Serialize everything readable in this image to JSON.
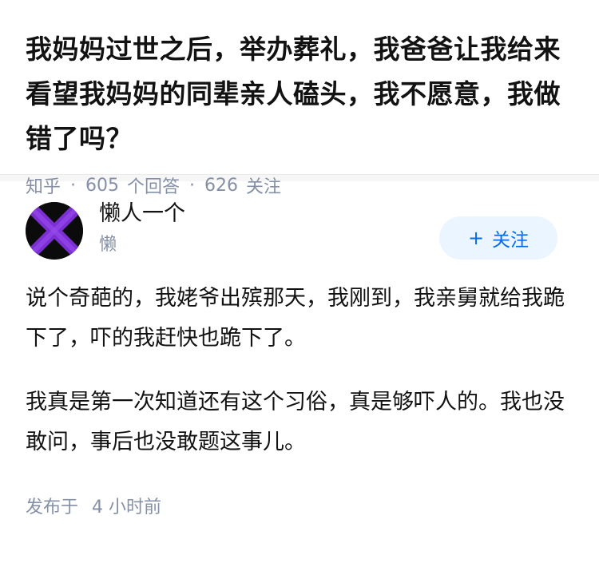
{
  "question": {
    "title": "我妈妈过世之后，举办葬礼，我爸爸让我给来看望我妈妈的同辈亲人磕头，我不愿意，我做错了吗？",
    "source": "知乎",
    "answers_count": "605",
    "answers_label": "个回答",
    "followers_count": "626",
    "followers_label": "关注",
    "separator": "·"
  },
  "answer": {
    "author_name": "懒人一个",
    "author_headline": "懒",
    "avatar_icon": "purple-x-avatar",
    "follow_label": "关注",
    "follow_icon": "plus-icon",
    "paragraphs": [
      "说个奇葩的，我姥爷出殡那天，我刚到，我亲舅就给我跪下了，吓的我赶快也跪下了。",
      "我真是第一次知道还有这个习俗，真是够吓人的。我也没敢问，事后也没敢题这事儿。"
    ],
    "published_label": "发布于",
    "published_time": "4 小时前"
  },
  "colors": {
    "text": "#121212",
    "meta": "#8590a6",
    "accent": "#056de8",
    "follow_bg": "#ebf5ff",
    "avatar_purple": "#7b2fd0"
  }
}
